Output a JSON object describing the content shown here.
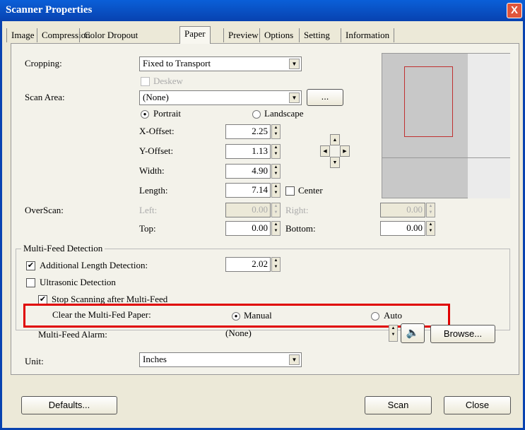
{
  "window": {
    "title": "Scanner Properties",
    "close": "X"
  },
  "tabs": [
    "Image",
    "Compression",
    "Color Dropout",
    "Paper",
    "Preview",
    "Options",
    "Setting",
    "Information"
  ],
  "paper": {
    "cropping_label": "Cropping:",
    "cropping_value": "Fixed to Transport",
    "deskew": "Deskew",
    "scan_area_label": "Scan Area:",
    "scan_area_value": "(None)",
    "scan_area_more": "...",
    "portrait": "Portrait",
    "landscape": "Landscape",
    "x_offset_label": "X-Offset:",
    "x_offset": "2.25",
    "y_offset_label": "Y-Offset:",
    "y_offset": "1.13",
    "width_label": "Width:",
    "width": "4.90",
    "length_label": "Length:",
    "length": "7.14",
    "center": "Center",
    "overscan_label": "OverScan:",
    "left_label": "Left:",
    "left": "0.00",
    "right_label": "Right:",
    "right": "0.00",
    "top_label": "Top:",
    "top": "0.00",
    "bottom_label": "Bottom:",
    "bottom": "0.00"
  },
  "multifeed": {
    "title": "Multi-Feed Detection",
    "additional_length": "Additional Length Detection:",
    "additional_length_value": "2.02",
    "ultrasonic": "Ultrasonic Detection",
    "stop_scanning": "Stop Scanning after Multi-Feed",
    "clear_label": "Clear the Multi-Fed Paper:",
    "manual": "Manual",
    "auto": "Auto",
    "alarm_label": "Multi-Feed Alarm:",
    "alarm_value": "(None)",
    "browse": "Browse..."
  },
  "unit": {
    "label": "Unit:",
    "value": "Inches"
  },
  "buttons": {
    "defaults": "Defaults...",
    "scan": "Scan",
    "close": "Close"
  },
  "colors": {
    "highlight": "#e00000",
    "titlebar": "#0a5fd8"
  }
}
